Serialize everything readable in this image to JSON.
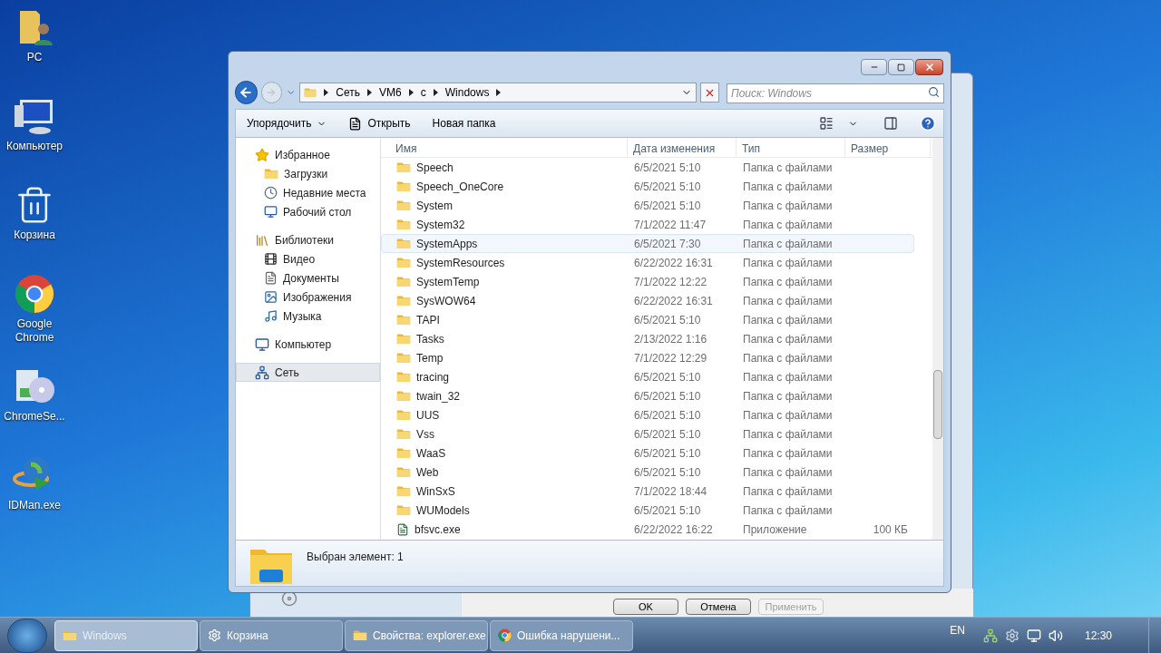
{
  "desktop_icons": [
    {
      "label": "PC",
      "kind": "user-folder"
    },
    {
      "label": "Компьютер",
      "kind": "computer"
    },
    {
      "label": "Корзина",
      "kind": "bin"
    },
    {
      "label": "Google Chrome",
      "kind": "chrome"
    },
    {
      "label": "ChromeSe...",
      "kind": "installer"
    },
    {
      "label": "IDMan.exe",
      "kind": "globe"
    }
  ],
  "back_dialog": {
    "buttons": [
      {
        "label": "OK",
        "disabled": false
      },
      {
        "label": "Отмена",
        "disabled": false
      },
      {
        "label": "Применить",
        "disabled": true
      }
    ]
  },
  "explorer": {
    "breadcrumb": [
      "Сеть",
      "VM6",
      "c",
      "Windows"
    ],
    "search": {
      "placeholder": "Поиск: Windows"
    },
    "toolbar": [
      {
        "label": "Упорядочить",
        "kind": "menu"
      },
      {
        "label": "Открыть",
        "kind": "open"
      },
      {
        "label": "Новая папка",
        "kind": "plain"
      }
    ],
    "nav": [
      {
        "label": "Избранное",
        "kind": "star",
        "selected": false,
        "children": [
          {
            "label": "Загрузки",
            "kind": "folder",
            "selected": false
          },
          {
            "label": "Недавние места",
            "kind": "recent",
            "selected": false
          },
          {
            "label": "Рабочий стол",
            "kind": "desktop",
            "selected": false
          }
        ]
      },
      {
        "label": "Библиотеки",
        "kind": "library",
        "selected": false,
        "children": [
          {
            "label": "Видео",
            "kind": "video",
            "selected": false
          },
          {
            "label": "Документы",
            "kind": "doc",
            "selected": false
          },
          {
            "label": "Изображения",
            "kind": "image",
            "selected": false
          },
          {
            "label": "Музыка",
            "kind": "music",
            "selected": false
          }
        ]
      },
      {
        "label": "Компьютер",
        "kind": "computer",
        "selected": false
      },
      {
        "label": "Сеть",
        "kind": "network",
        "selected": true
      }
    ],
    "columns": [
      "Имя",
      "Дата изменения",
      "Тип",
      "Размер"
    ],
    "rows": [
      {
        "name": "Speech",
        "date": "6/5/2021 5:10",
        "type": "Папка с файлами",
        "kind": "folder",
        "hovered": false
      },
      {
        "name": "Speech_OneCore",
        "date": "6/5/2021 5:10",
        "type": "Папка с файлами",
        "kind": "folder",
        "hovered": false
      },
      {
        "name": "System",
        "date": "6/5/2021 5:10",
        "type": "Папка с файлами",
        "kind": "folder",
        "hovered": false
      },
      {
        "name": "System32",
        "date": "7/1/2022 11:47",
        "type": "Папка с файлами",
        "kind": "folder",
        "hovered": false
      },
      {
        "name": "SystemApps",
        "date": "6/5/2021 7:30",
        "type": "Папка с файлами",
        "kind": "folder",
        "hovered": true
      },
      {
        "name": "SystemResources",
        "date": "6/22/2022 16:31",
        "type": "Папка с файлами",
        "kind": "folder",
        "hovered": false
      },
      {
        "name": "SystemTemp",
        "date": "7/1/2022 12:22",
        "type": "Папка с файлами",
        "kind": "folder",
        "hovered": false
      },
      {
        "name": "SysWOW64",
        "date": "6/22/2022 16:31",
        "type": "Папка с файлами",
        "kind": "folder",
        "hovered": false
      },
      {
        "name": "TAPI",
        "date": "6/5/2021 5:10",
        "type": "Папка с файлами",
        "kind": "folder",
        "hovered": false
      },
      {
        "name": "Tasks",
        "date": "2/13/2022 1:16",
        "type": "Папка с файлами",
        "kind": "folder",
        "hovered": false
      },
      {
        "name": "Temp",
        "date": "7/1/2022 12:29",
        "type": "Папка с файлами",
        "kind": "folder",
        "hovered": false
      },
      {
        "name": "tracing",
        "date": "6/5/2021 5:10",
        "type": "Папка с файлами",
        "kind": "folder",
        "hovered": false
      },
      {
        "name": "twain_32",
        "date": "6/5/2021 5:10",
        "type": "Папка с файлами",
        "kind": "folder",
        "hovered": false
      },
      {
        "name": "UUS",
        "date": "6/5/2021 5:10",
        "type": "Папка с файлами",
        "kind": "folder",
        "hovered": false
      },
      {
        "name": "Vss",
        "date": "6/5/2021 5:10",
        "type": "Папка с файлами",
        "kind": "folder",
        "hovered": false
      },
      {
        "name": "WaaS",
        "date": "6/5/2021 5:10",
        "type": "Папка с файлами",
        "kind": "folder",
        "hovered": false
      },
      {
        "name": "Web",
        "date": "6/5/2021 5:10",
        "type": "Папка с файлами",
        "kind": "folder",
        "hovered": false
      },
      {
        "name": "WinSxS",
        "date": "7/1/2022 18:44",
        "type": "Папка с файлами",
        "kind": "folder",
        "hovered": false
      },
      {
        "name": "WUModels",
        "date": "6/5/2021 5:10",
        "type": "Папка с файлами",
        "kind": "folder",
        "hovered": false
      },
      {
        "name": "bfsvc.exe",
        "date": "6/22/2022 16:22",
        "type": "Приложение",
        "size": "100 КБ",
        "kind": "exe",
        "hovered": false
      }
    ],
    "status": "Выбран элемент: 1"
  },
  "taskbar": {
    "items": [
      {
        "label": "Windows",
        "kind": "folder",
        "selected": true
      },
      {
        "label": "Корзина",
        "kind": "gear",
        "selected": false
      },
      {
        "label": "Свойства: explorer.exe",
        "kind": "folder",
        "selected": false
      },
      {
        "label": "Ошибка нарушени...",
        "kind": "chrome",
        "selected": false
      }
    ],
    "language": "EN",
    "time": "12:30"
  }
}
